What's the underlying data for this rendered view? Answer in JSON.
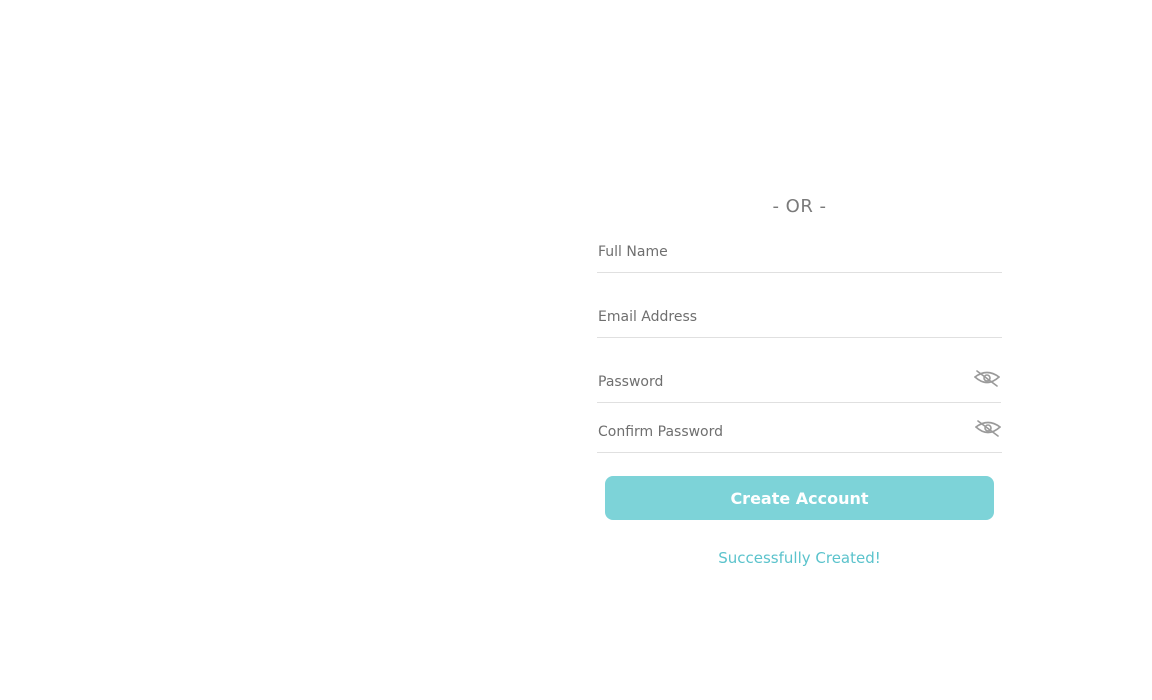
{
  "divider": {
    "text": "- OR -"
  },
  "form": {
    "full_name": {
      "placeholder": "Full Name",
      "value": ""
    },
    "email": {
      "placeholder": "Email Address",
      "value": ""
    },
    "password": {
      "placeholder": "Password",
      "value": "",
      "toggle_icon": "eye-off-icon"
    },
    "confirm_password": {
      "placeholder": "Confirm Password",
      "value": "",
      "toggle_icon": "eye-off-icon"
    },
    "submit_label": "Create Account",
    "status_message": "Successfully Created!"
  },
  "colors": {
    "accent": "#7dd3d8",
    "status_text": "#5bc3cc",
    "placeholder_text": "#6f6f6f",
    "divider_text": "#7a7a7a",
    "field_border": "#e0e0e0"
  }
}
